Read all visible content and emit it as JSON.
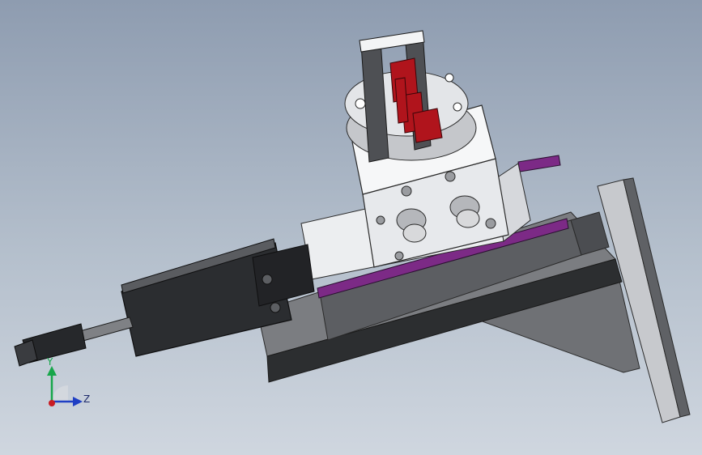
{
  "view": {
    "type": "cad-3d-viewport",
    "background_top": "#8e9cb0",
    "background_bottom": "#cfd6df"
  },
  "model": {
    "description_icons": [
      "gripper-fixture-model"
    ],
    "colors": {
      "gripper_jaw": "#b0141c",
      "linear_rail": "#7c2a86",
      "cylinder_body": "#2b2d30",
      "frame_dark": "#2d2f31",
      "frame_mid": "#77797d",
      "frame_light": "#c9cbcf",
      "housing_white": "#f1f2f4"
    }
  },
  "triad": {
    "y_label": "Y",
    "z_label": "Z",
    "y_color": "#17a64a",
    "z_color": "#1f3fc4",
    "x_color": "#c81b22"
  }
}
